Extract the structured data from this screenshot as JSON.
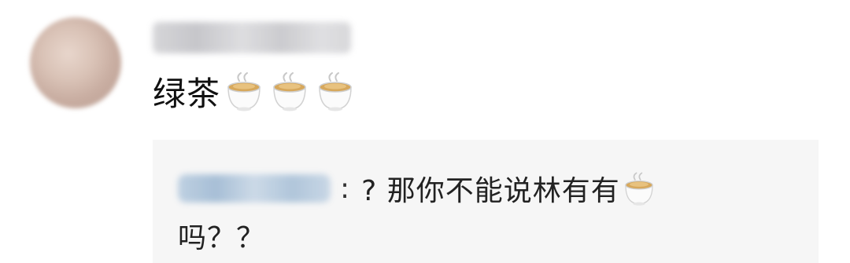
{
  "comment": {
    "text": "绿茶",
    "emoji_icons": [
      "teacup-icon",
      "teacup-icon",
      "teacup-icon"
    ]
  },
  "reply": {
    "separator": ":",
    "line1": "? 那你不能说林有有",
    "line1_emoji_icon": "teacup-icon",
    "line2": "吗？？"
  },
  "colors": {
    "background": "#ffffff",
    "reply_background": "#f6f6f6",
    "text": "#111111"
  }
}
